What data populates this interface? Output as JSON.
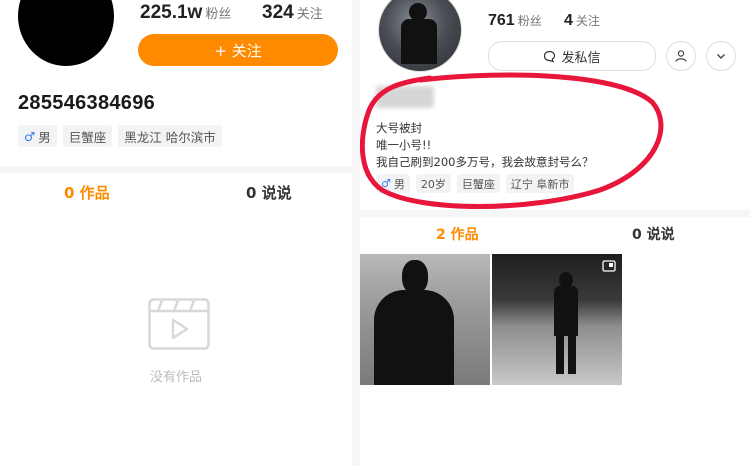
{
  "left": {
    "followers": {
      "value": "225.1w",
      "label": "粉丝"
    },
    "following": {
      "value": "324",
      "label": "关注"
    },
    "follow_button": {
      "icon": "plus-icon",
      "label": "+ 关注"
    },
    "user_id": "285546384696",
    "tags": [
      {
        "icon": "male-icon",
        "symbol": "♂",
        "text": "男"
      },
      {
        "text": "巨蟹座"
      },
      {
        "text": "黑龙江 哈尔滨市"
      }
    ],
    "tabs": [
      {
        "label": "0 作品",
        "active": true
      },
      {
        "label": "0 说说",
        "active": false
      }
    ],
    "empty_state": {
      "icon": "video-clip-icon",
      "text": "没有作品"
    }
  },
  "right": {
    "followers": {
      "value": "761",
      "label": "粉丝"
    },
    "following": {
      "value": "4",
      "label": "关注"
    },
    "message_button": {
      "icon": "chat-bubble-icon",
      "label": "发私信"
    },
    "profile_button_icon": "user-icon",
    "more_button_icon": "chevron-down-icon",
    "bio_lines": [
      "大号被封",
      "唯一小号!!",
      "我自己刷到200多万号，我会故意封号么？"
    ],
    "tags": [
      {
        "icon": "male-icon",
        "symbol": "♂",
        "text": "男"
      },
      {
        "text": "20岁"
      },
      {
        "text": "巨蟹座"
      },
      {
        "text": "辽宁 阜新市"
      }
    ],
    "tabs": [
      {
        "label": "2 作品",
        "active": true
      },
      {
        "label": "0 说说",
        "active": false
      }
    ],
    "annotation_color": "#e8163b"
  },
  "colors": {
    "accent": "#ff8a00",
    "male": "#3a7df2"
  }
}
